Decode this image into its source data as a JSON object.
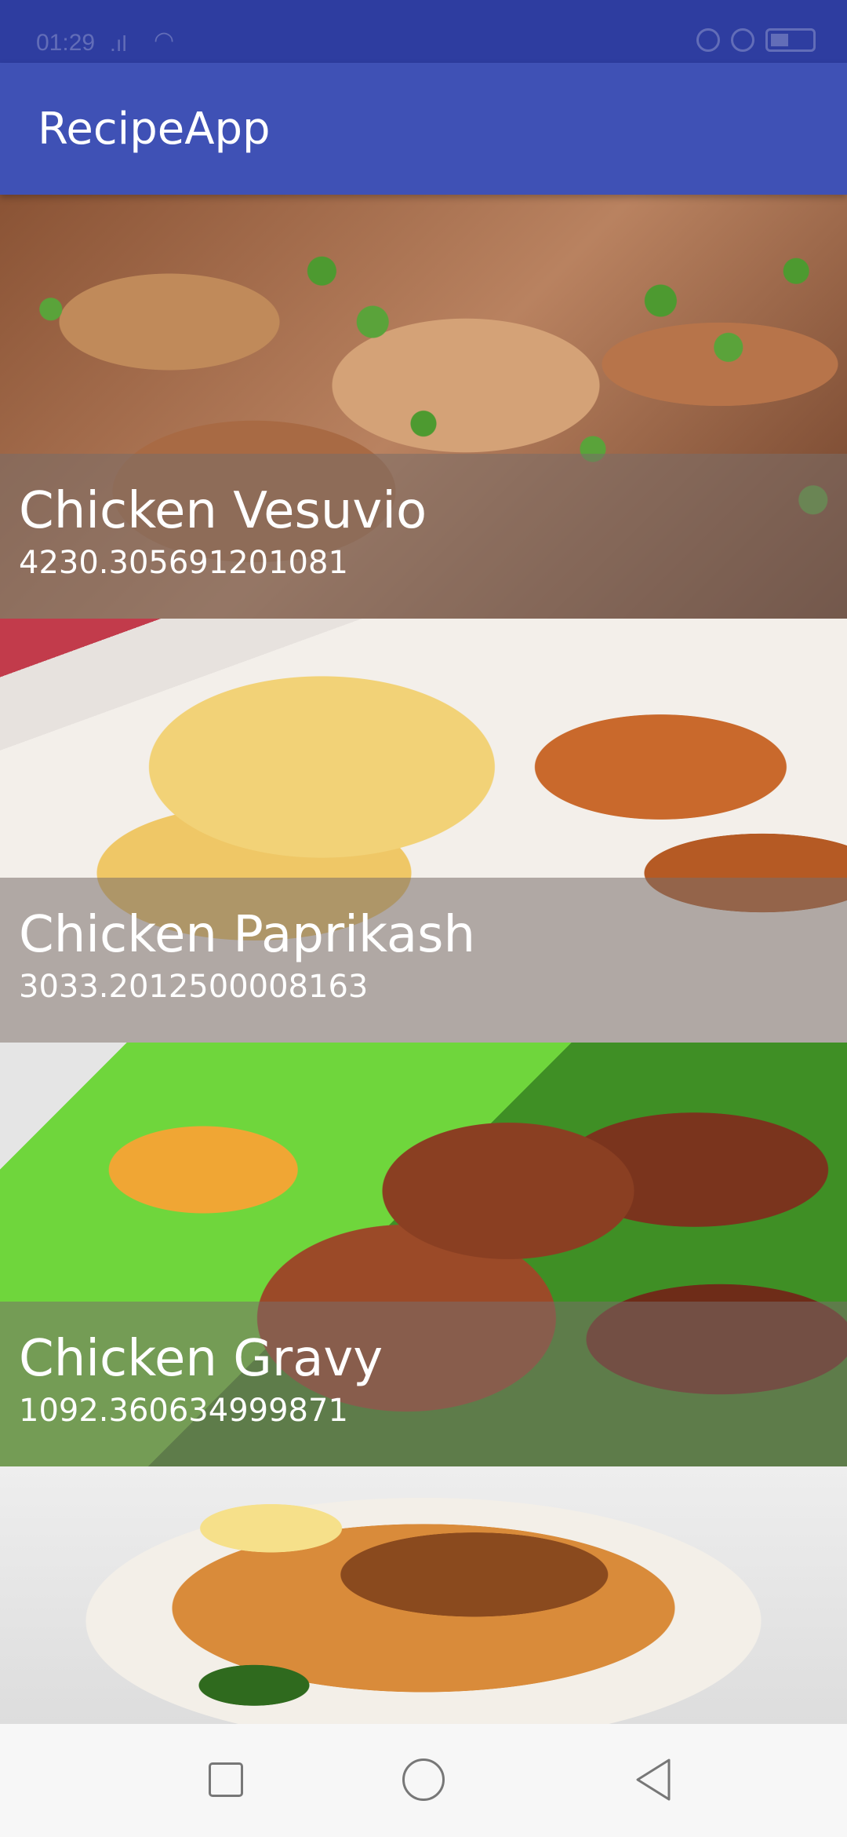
{
  "app": {
    "title": "RecipeApp",
    "status_time": "01:29",
    "accent_color": "#3f51b5",
    "status_bar_color": "#2e3da0"
  },
  "recipes": [
    {
      "name": "Chicken Vesuvio",
      "score": "4230.305691201081"
    },
    {
      "name": "Chicken Paprikash",
      "score": "3033.2012500008163"
    },
    {
      "name": "Chicken Gravy",
      "score": "1092.360634999871"
    },
    {
      "name": "",
      "score": ""
    }
  ],
  "navigation": {
    "icons": [
      "recent-apps-icon",
      "home-icon",
      "back-icon"
    ]
  }
}
